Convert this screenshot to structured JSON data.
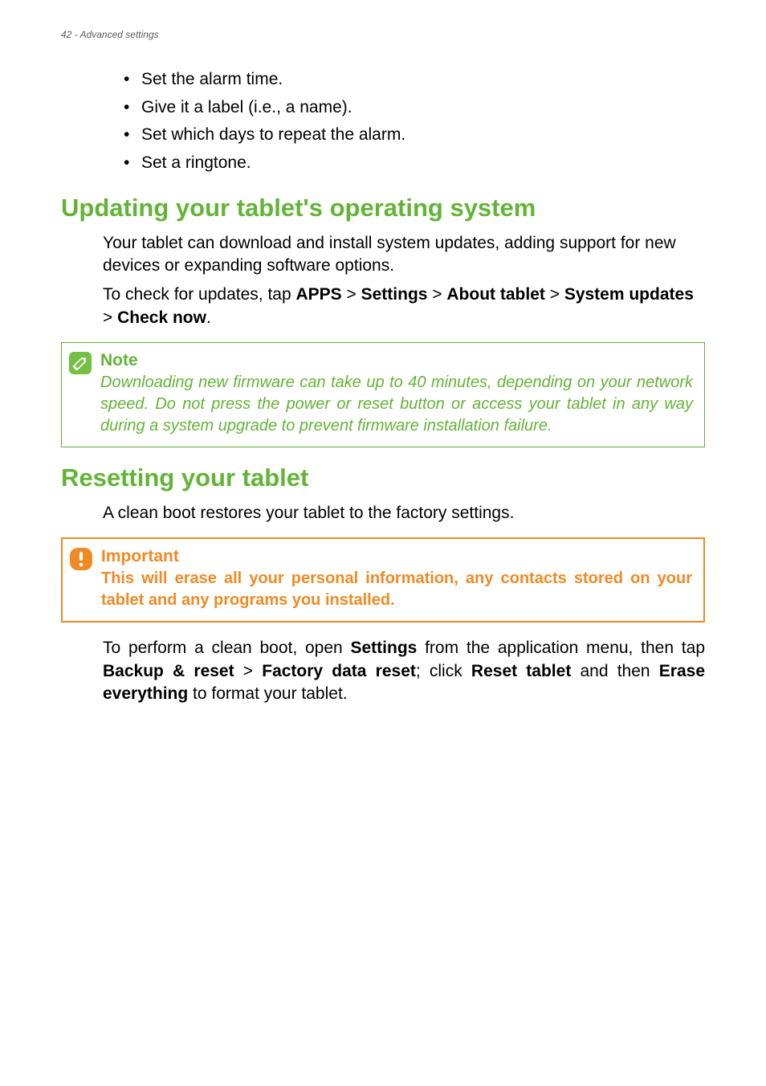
{
  "header": {
    "page_number": "42",
    "section_name": "Advanced settings"
  },
  "bullets": [
    "Set the alarm time.",
    "Give it a label (i.e., a name).",
    "Set which days to repeat the alarm.",
    "Set a ringtone."
  ],
  "section1": {
    "heading": "Updating your tablet's operating system",
    "para1": "Your tablet can download and install system updates, adding support for new devices or expanding software options.",
    "para2_parts": {
      "t1": "To check for updates, tap ",
      "b1": "APPS",
      "t2": " > ",
      "b2": "Settings",
      "t3": " > ",
      "b3": "About tablet",
      "t4": " > ",
      "b4": "System updates",
      "t5": " > ",
      "b5": "Check now",
      "t6": "."
    }
  },
  "note": {
    "title": "Note",
    "body": "Downloading new firmware can take up to 40 minutes, depending on your network speed. Do not press the power or reset button or access your tablet in any way during a system upgrade to prevent firmware installation failure."
  },
  "section2": {
    "heading": "Resetting your tablet",
    "para1": "A clean boot restores your tablet to the factory settings."
  },
  "important": {
    "title": "Important",
    "body": "This will erase all your personal information, any contacts stored on your tablet and any programs you installed."
  },
  "section2_para2": {
    "t1": "To perform a clean boot, open ",
    "b1": "Settings",
    "t2": " from the application menu, then tap ",
    "b2": "Backup & reset",
    "t3": " > ",
    "b3": "Factory data reset",
    "t4": "; click ",
    "b4": "Reset tablet",
    "t5": " and then ",
    "b5": "Erase everything",
    "t6": " to format your tablet."
  }
}
